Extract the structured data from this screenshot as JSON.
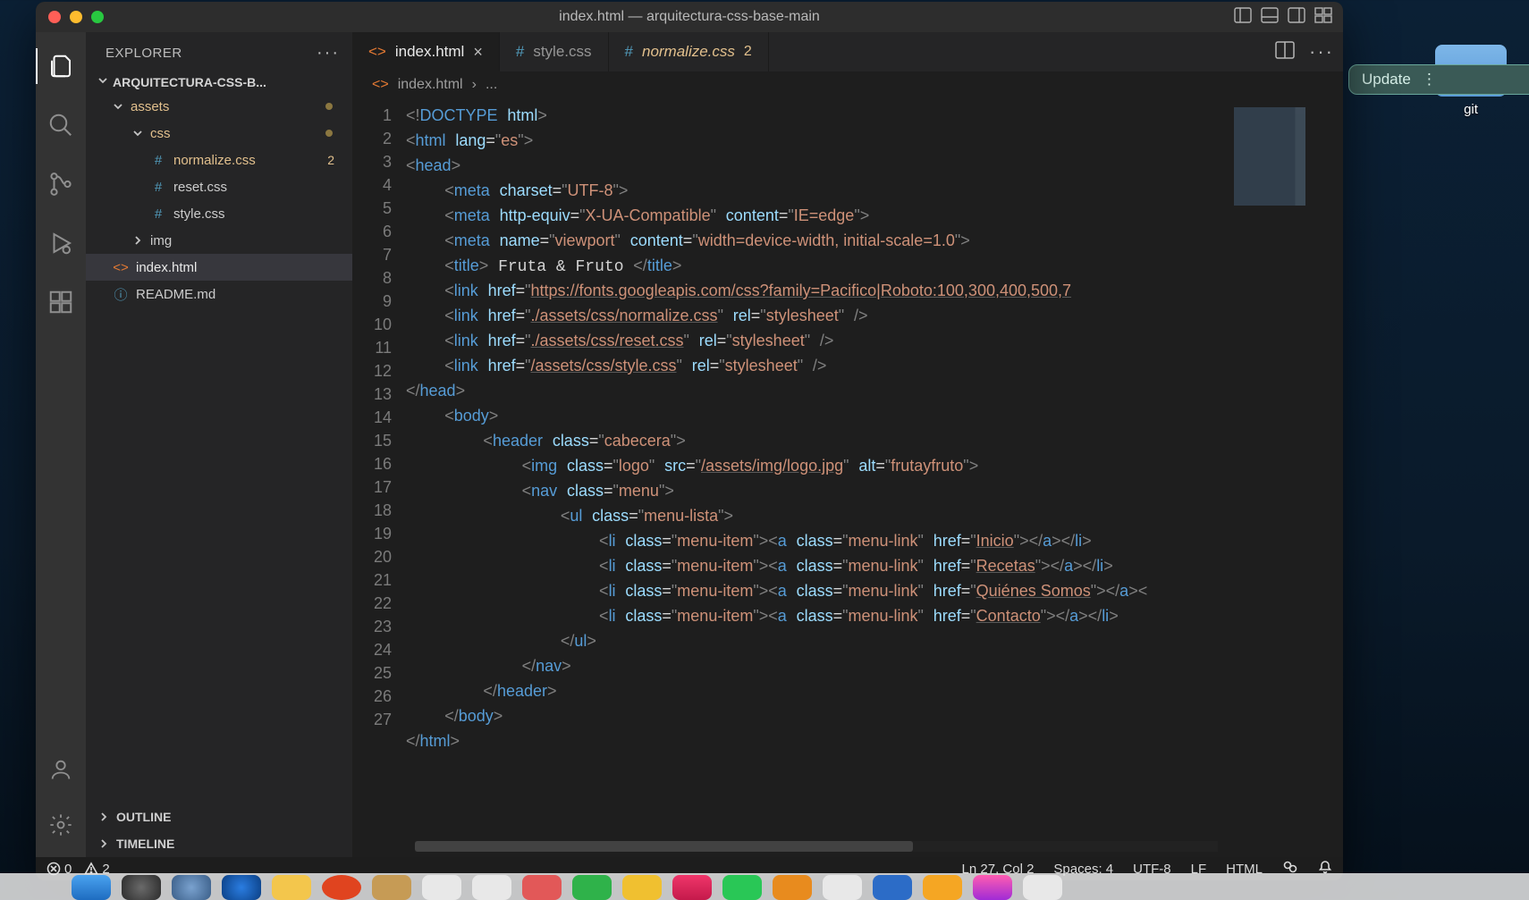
{
  "window": {
    "title": "index.html — arquitectura-css-base-main"
  },
  "toolbarRight": {
    "update": "Update"
  },
  "desktop": {
    "folder1": "git"
  },
  "sidebar": {
    "header": "EXPLORER",
    "project": "ARQUITECTURA-CSS-B...",
    "outline": "OUTLINE",
    "timeline": "TIMELINE",
    "tree": {
      "assets": "assets",
      "css": "css",
      "normalize": "normalize.css",
      "normalizeBadge": "2",
      "reset": "reset.css",
      "style": "style.css",
      "img": "img",
      "index": "index.html",
      "readme": "README.md"
    }
  },
  "tabs": {
    "t1": "index.html",
    "t2": "style.css",
    "t3": "normalize.css",
    "t3badge": "2"
  },
  "crumbs": {
    "file": "index.html",
    "rest": "..."
  },
  "gutter": [
    "1",
    "2",
    "3",
    "4",
    "5",
    "6",
    "7",
    "8",
    "9",
    "10",
    "11",
    "12",
    "13",
    "14",
    "15",
    "16",
    "17",
    "18",
    "19",
    "20",
    "21",
    "22",
    "23",
    "24",
    "25",
    "26",
    "27"
  ],
  "status": {
    "errors": "0",
    "warnings": "2",
    "lncol": "Ln 27, Col 2",
    "spaces": "Spaces: 4",
    "enc": "UTF-8",
    "eol": "LF",
    "lang": "HTML"
  },
  "code": {
    "title_text": "Fruta & Fruto",
    "lang": "es",
    "charset": "UTF-8",
    "xuacompat": "X-UA-Compatible",
    "ieedge": "IE=edge",
    "viewport_name": "viewport",
    "viewport_content": "width=device-width, initial-scale=1.0",
    "fonts_url": "https://fonts.googleapis.com/css?family=Pacifico|Roboto:100,300,400,500,7",
    "normalize_href": "./assets/css/normalize.css",
    "reset_href": "./assets/css/reset.css",
    "style_href": "/assets/css/style.css",
    "stylesheet": "stylesheet",
    "hdr_class": "cabecera",
    "img_class": "logo",
    "img_src": "/assets/img/logo.jpg",
    "img_alt": "frutayfruto",
    "nav_class": "menu",
    "ul_class": "menu-lista",
    "li_class": "menu-item",
    "a_class": "menu-link",
    "links": {
      "inicio": "Inicio",
      "recetas": "Recetas",
      "quienes": "Quiénes Somos",
      "contacto": "Contacto"
    }
  }
}
